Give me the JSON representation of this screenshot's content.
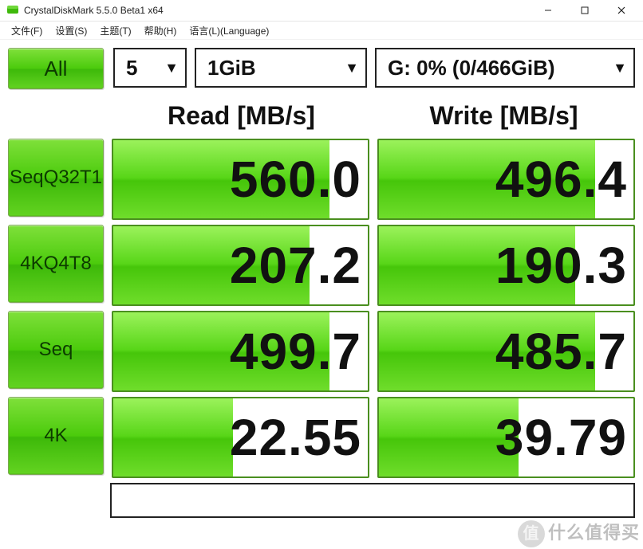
{
  "window": {
    "title": "CrystalDiskMark 5.5.0 Beta1 x64"
  },
  "menu": {
    "file": "文件(F)",
    "settings": "设置(S)",
    "theme": "主题(T)",
    "help": "帮助(H)",
    "language": "语言(L)(Language)"
  },
  "controls": {
    "all_label": "All",
    "runs": "5",
    "size": "1GiB",
    "drive": "G: 0% (0/466GiB)"
  },
  "headers": {
    "read": "Read [MB/s]",
    "write": "Write [MB/s]"
  },
  "rows": [
    {
      "label": "Seq\nQ32T1",
      "read": "560.0",
      "read_pct": 85,
      "write": "496.4",
      "write_pct": 85
    },
    {
      "label": "4K\nQ4T8",
      "read": "207.2",
      "read_pct": 77,
      "write": "190.3",
      "write_pct": 77
    },
    {
      "label": "Seq",
      "read": "499.7",
      "read_pct": 85,
      "write": "485.7",
      "write_pct": 85
    },
    {
      "label": "4K",
      "read": "22.55",
      "read_pct": 47,
      "write": "39.79",
      "write_pct": 55
    }
  ],
  "watermark": {
    "ball": "值",
    "text": "什么值得买"
  }
}
